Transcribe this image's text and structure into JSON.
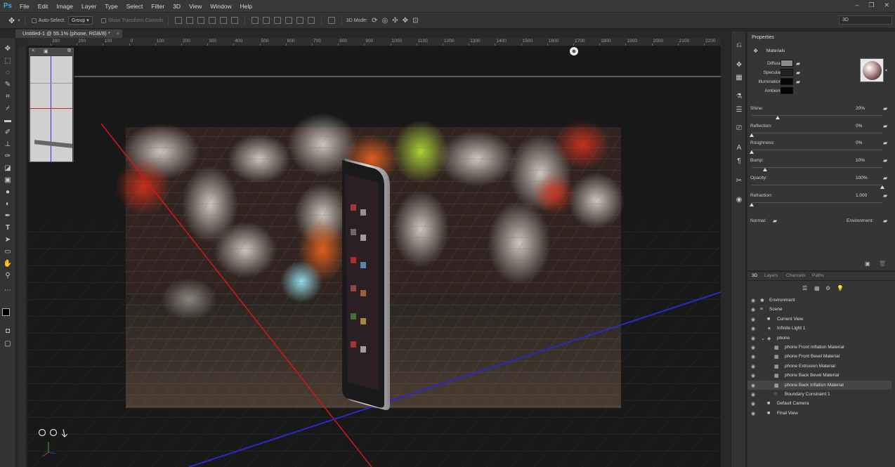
{
  "app": {
    "logo": "Ps"
  },
  "menu": [
    "File",
    "Edit",
    "Image",
    "Layer",
    "Type",
    "Select",
    "Filter",
    "3D",
    "View",
    "Window",
    "Help"
  ],
  "options": {
    "auto_select": "Auto-Select:",
    "group": "Group",
    "show_transform": "Show Transform Controls",
    "mode3d": "3D Mode:"
  },
  "workspace": "3D",
  "document": {
    "tab_title": "Untitled-1 @ 55.1% (phone, RGB/8) *",
    "close": "×"
  },
  "ruler": {
    "labels": [
      "300",
      "200",
      "100",
      "0",
      "100",
      "200",
      "300",
      "400",
      "500",
      "600",
      "700",
      "800",
      "900",
      "1000",
      "1100",
      "1200",
      "1300",
      "1400",
      "1500",
      "1600",
      "1700",
      "1800",
      "1900",
      "2000",
      "2100",
      "2200"
    ]
  },
  "properties": {
    "panel_title": "Properties",
    "section": "Materials",
    "diffuse": "Diffuse:",
    "specular": "Specular:",
    "illumination": "Illumination:",
    "ambient": "Ambient:",
    "colors": {
      "diffuse": "#8a8a8a",
      "specular": "#222222",
      "illumination": "#050505",
      "ambient": "#050505"
    },
    "sliders": [
      {
        "label": "Shine:",
        "value": "20%",
        "fraction": 0.2
      },
      {
        "label": "Reflection:",
        "value": "0%",
        "fraction": 0.0
      },
      {
        "label": "Roughness:",
        "value": "0%",
        "fraction": 0.0
      },
      {
        "label": "Bump:",
        "value": "10%",
        "fraction": 0.1
      },
      {
        "label": "Opacity:",
        "value": "100%",
        "fraction": 1.0
      },
      {
        "label": "Refraction:",
        "value": "1.000",
        "fraction": 0.0
      }
    ],
    "normal": "Normal:",
    "environment": "Environment:"
  },
  "layers_panel": {
    "tabs": [
      "3D",
      "Layers",
      "Channels",
      "Paths"
    ],
    "items": [
      {
        "label": "Environment",
        "icon": "environment-icon",
        "glyph": "✱",
        "indent": 0
      },
      {
        "label": "Scene",
        "icon": "scene-icon",
        "glyph": "≡",
        "indent": 0
      },
      {
        "label": "Current View",
        "icon": "camera-icon",
        "glyph": "■",
        "indent": 1
      },
      {
        "label": "Infinite Light 1",
        "icon": "light-icon",
        "glyph": "✶",
        "indent": 1
      },
      {
        "label": "phone",
        "icon": "mesh-icon",
        "glyph": "◈",
        "indent": 1
      },
      {
        "label": "phone Front Inflation Material",
        "icon": "material-icon",
        "glyph": "▦",
        "indent": 2
      },
      {
        "label": "phone Front Bevel Material",
        "icon": "material-icon",
        "glyph": "▦",
        "indent": 2
      },
      {
        "label": "phone Extrusion Material",
        "icon": "material-icon",
        "glyph": "▦",
        "indent": 2
      },
      {
        "label": "phone Back Bevel Material",
        "icon": "material-icon",
        "glyph": "▦",
        "indent": 2
      },
      {
        "label": "phone Back Inflation Material",
        "icon": "material-icon",
        "glyph": "▦",
        "indent": 2,
        "selected": true
      },
      {
        "label": "Boundary Constraint 1",
        "icon": "constraint-icon",
        "glyph": "○",
        "indent": 2
      },
      {
        "label": "Default Camera",
        "icon": "camera-icon",
        "glyph": "■",
        "indent": 1
      },
      {
        "label": "Final View",
        "icon": "camera-icon",
        "glyph": "■",
        "indent": 1
      }
    ]
  }
}
